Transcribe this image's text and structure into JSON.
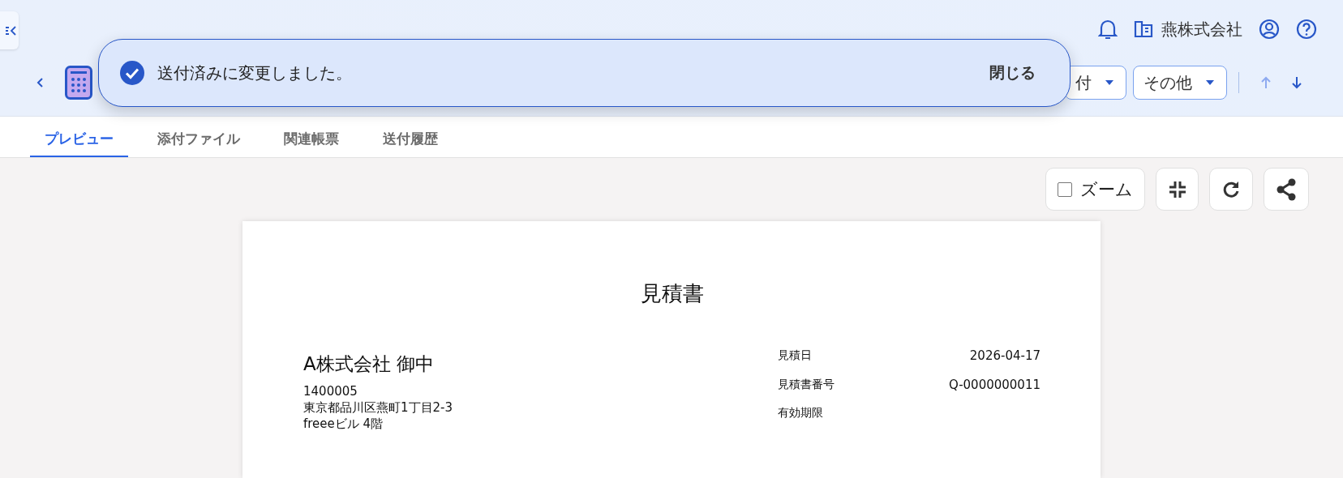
{
  "header": {
    "company": "燕株式会社",
    "actions": [
      {
        "label": "付",
        "kind": "dropdown"
      },
      {
        "label": "その他",
        "kind": "dropdown"
      }
    ]
  },
  "toast": {
    "message": "送付済みに変更しました。",
    "close_label": "閉じる"
  },
  "tabs": [
    {
      "label": "プレビュー",
      "selected": true
    },
    {
      "label": "添付ファイル",
      "selected": false
    },
    {
      "label": "関連帳票",
      "selected": false
    },
    {
      "label": "送付履歴",
      "selected": false
    }
  ],
  "preview_toolbar": {
    "zoom": {
      "label": "ズーム",
      "checked": false
    }
  },
  "document": {
    "title": "見積書",
    "recipient": "A株式会社 御中",
    "address_lines": [
      "1400005",
      "東京都品川区燕町1丁目2-3",
      "freeeビル 4階"
    ],
    "fields": [
      {
        "label": "見積日",
        "value": "2026-04-17"
      },
      {
        "label": "見積書番号",
        "value": "Q-0000000011"
      },
      {
        "label": "有効期限"
      }
    ]
  }
}
